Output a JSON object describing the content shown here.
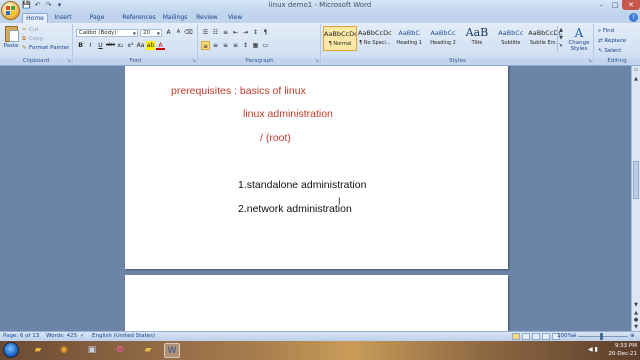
{
  "window": {
    "title": "linux demo1 - Microsoft Word",
    "minimize": "–",
    "maximize": "□",
    "close": "✕"
  },
  "qat": {
    "save": "💾",
    "undo": "↶",
    "redo": "↷",
    "more": "▾"
  },
  "tabs": [
    "Home",
    "Insert",
    "Page Layout",
    "References",
    "Mailings",
    "Review",
    "View"
  ],
  "help": "?",
  "clipboard": {
    "paste": "Paste",
    "cut": "Cut",
    "copy": "Copy",
    "format_painter": "Format Painter",
    "group": "Clipboard"
  },
  "font": {
    "name": "Calibri (Body)",
    "size": "20",
    "group": "Font",
    "row1": [
      "A",
      "A",
      "⌫"
    ],
    "row2": [
      "B",
      "I",
      "U",
      "abc",
      "x₂",
      "x²",
      "Aa",
      "ab",
      "A"
    ]
  },
  "paragraph": {
    "group": "Paragraph",
    "row1": [
      "☰",
      "☷",
      "≡",
      "⇤",
      "⇥",
      "↕",
      "¶"
    ],
    "row2": [
      "≡",
      "≡",
      "≡",
      "≡",
      "↕",
      "▦",
      "▭"
    ]
  },
  "styles": {
    "group": "Styles",
    "items": [
      {
        "preview": "AaBbCcDc",
        "name": "¶ Normal",
        "kind": "normal",
        "active": true
      },
      {
        "preview": "AaBbCcDc",
        "name": "¶ No Spaci...",
        "kind": "normal",
        "active": false
      },
      {
        "preview": "AaBbC",
        "name": "Heading 1",
        "kind": "heading",
        "active": false
      },
      {
        "preview": "AaBbCc",
        "name": "Heading 2",
        "kind": "heading",
        "active": false
      },
      {
        "preview": "AaB",
        "name": "Title",
        "kind": "title",
        "active": false
      },
      {
        "preview": "AaBbCc",
        "name": "Subtitle",
        "kind": "heading",
        "active": false
      },
      {
        "preview": "AaBbCcDc",
        "name": "Subtle Em...",
        "kind": "normal",
        "active": false
      }
    ],
    "change_styles": "Change Styles"
  },
  "editing": {
    "group": "Editing",
    "find": "Find",
    "replace": "Replace",
    "select": "Select"
  },
  "document": {
    "lines": [
      {
        "text": "prerequisites : basics of linux",
        "color": "#c0392b"
      },
      {
        "text": "linux administration",
        "color": "#c0392b"
      },
      {
        "text": "/ (root)",
        "color": "#c0392b"
      },
      {
        "text": "1.standalone administration",
        "color": "#111111"
      },
      {
        "text": "2.network administration",
        "color": "#111111"
      }
    ]
  },
  "status": {
    "page": "Page: 6 of 13",
    "words": "Words: 425",
    "language": "English (United States)",
    "zoom": "100%",
    "zoom_value": 100
  },
  "taskbar": {
    "time": "9:33 PM",
    "date": "20-Dec-21"
  }
}
